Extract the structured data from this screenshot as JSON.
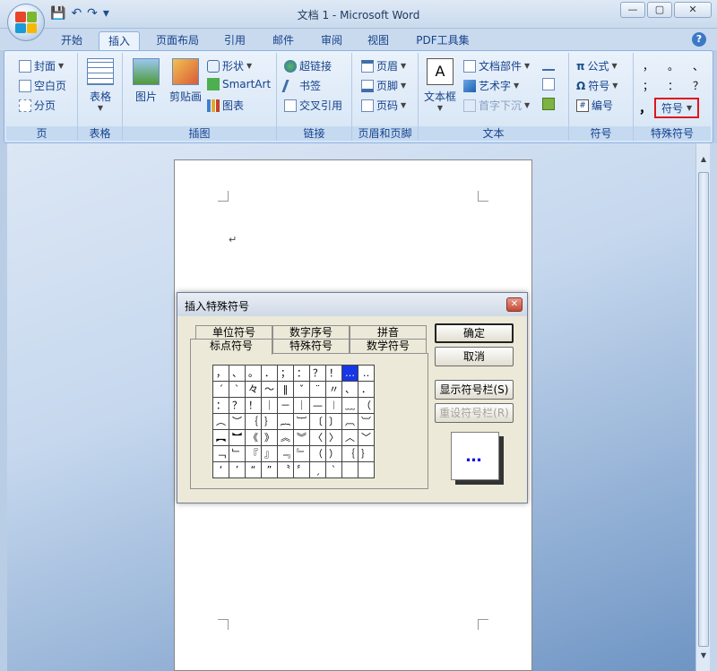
{
  "window": {
    "title": "文档 1 - Microsoft Word",
    "controls": {
      "minimize": "—",
      "maximize": "▢",
      "close": "✕"
    }
  },
  "quick_access": {
    "save": "💾",
    "undo": "↶",
    "redo": "↷",
    "customize": "▾"
  },
  "tabs": [
    "开始",
    "插入",
    "页面布局",
    "引用",
    "邮件",
    "审阅",
    "视图",
    "PDF工具集"
  ],
  "active_tab": "插入",
  "help": "?",
  "ribbon": {
    "page_group": {
      "label": "页",
      "items": [
        "封面",
        "空白页",
        "分页"
      ]
    },
    "table_group": {
      "label": "表格",
      "button": "表格"
    },
    "illustrations_group": {
      "label": "插图",
      "picture": "图片",
      "clipart": "剪贴画",
      "shapes": "形状",
      "smartart": "SmartArt",
      "chart": "图表"
    },
    "links_group": {
      "label": "链接",
      "items": [
        "超链接",
        "书签",
        "交叉引用"
      ]
    },
    "header_footer_group": {
      "label": "页眉和页脚",
      "items": [
        "页眉",
        "页脚",
        "页码"
      ]
    },
    "text_group": {
      "label": "文本",
      "textbox": "文本框",
      "items": [
        "文档部件",
        "艺术字",
        "首字下沉"
      ]
    },
    "symbols_group": {
      "label": "符号",
      "items": [
        "公式",
        "符号",
        "编号"
      ]
    },
    "special_group": {
      "label": "特殊符号",
      "chars_row1": [
        "，",
        "。",
        "、"
      ],
      "chars_row2": [
        "；",
        "：",
        "？"
      ],
      "big_char": "，",
      "symbol_button": "符号"
    }
  },
  "document": {
    "paragraph_mark": "↵"
  },
  "dialog": {
    "title": "插入特殊符号",
    "close": "✕",
    "tabs_back": [
      "单位符号",
      "数字序号",
      "拼音"
    ],
    "tabs_front": [
      "标点符号",
      "特殊符号",
      "数学符号"
    ],
    "active_tab": "标点符号",
    "grid": [
      [
        "，",
        "、",
        "。",
        "．",
        "；",
        "：",
        "？",
        "！",
        "…",
        "‥"
      ],
      [
        "ˊ",
        "ˋ",
        "々",
        "～",
        "‖",
        "ˇ",
        "¨",
        "〃",
        "、",
        "．"
      ],
      [
        "：",
        "？",
        "！",
        "｜",
        "－",
        "｜",
        "—",
        "︱",
        "﹏",
        "（"
      ],
      [
        "︵",
        "︶",
        "｛",
        "｝",
        "︷",
        "︸",
        "〔",
        "〕",
        "︹",
        "︺"
      ],
      [
        "︻",
        "︼",
        "《",
        "》",
        "︽",
        "︾",
        "〈",
        "〉",
        "︿",
        "﹀"
      ],
      [
        "﹁",
        "﹂",
        "『",
        "』",
        "﹃",
        "﹄",
        "（",
        "）",
        "｛",
        "｝"
      ],
      [
        "‘",
        "’",
        "“",
        "”",
        "〝",
        "〞",
        "ˏ",
        "ˋ",
        "",
        ""
      ]
    ],
    "selected_cell": [
      0,
      8
    ],
    "buttons": {
      "ok": "确定",
      "cancel": "取消",
      "show_bar": "显示符号栏(S)",
      "reset_bar": "重设符号栏(R)"
    },
    "preview": "…"
  }
}
